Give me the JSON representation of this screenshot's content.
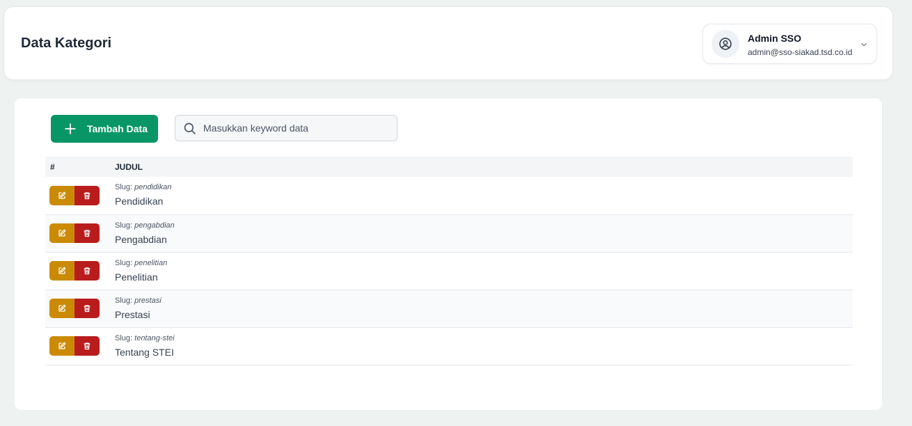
{
  "header": {
    "title": "Data Kategori",
    "user": {
      "name": "Admin SSO",
      "email": "admin@sso-siakad.tsd.co.id"
    }
  },
  "toolbar": {
    "add_label": "Tambah Data",
    "search_placeholder": "Masukkan keyword data"
  },
  "table": {
    "columns": [
      "#",
      "JUDUL"
    ],
    "slug_prefix": "Slug:",
    "rows": [
      {
        "slug": "pendidikan",
        "title": "Pendidikan"
      },
      {
        "slug": "pengabdian",
        "title": "Pengabdian"
      },
      {
        "slug": "penelitian",
        "title": "Penelitian"
      },
      {
        "slug": "prestasi",
        "title": "Prestasi"
      },
      {
        "slug": "tentang-stei",
        "title": "Tentang STEI"
      }
    ]
  },
  "colors": {
    "primary": "#089667",
    "edit": "#ca8a04",
    "delete": "#b91c1c"
  }
}
